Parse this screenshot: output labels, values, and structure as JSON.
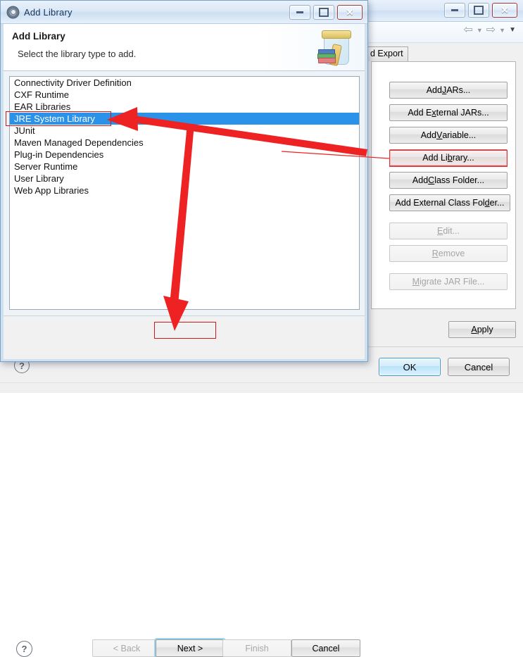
{
  "background_window": {
    "window_controls": [
      {
        "name": "minimize",
        "glyph": "minimize-icon"
      },
      {
        "name": "maximize",
        "glyph": "maximize-icon"
      },
      {
        "name": "close",
        "glyph": "close-icon",
        "label": "✕"
      }
    ],
    "toolbar": {
      "back_arrow": "⇦",
      "back_caret": "▼",
      "forward_arrow": "⇨",
      "forward_caret": "▼",
      "menu_caret": "▼"
    },
    "tab_label": "d Export",
    "buttons": [
      {
        "label_pre": "Add ",
        "mnemonic": "J",
        "label_post": "ARs...",
        "enabled": true,
        "highlighted": false
      },
      {
        "label_pre": "Add E",
        "mnemonic": "x",
        "label_post": "ternal JARs...",
        "enabled": true,
        "highlighted": false
      },
      {
        "label_pre": "Add ",
        "mnemonic": "V",
        "label_post": "ariable...",
        "enabled": true,
        "highlighted": false
      },
      {
        "label_pre": "Add Li",
        "mnemonic": "b",
        "label_post": "rary...",
        "enabled": true,
        "highlighted": true
      },
      {
        "label_pre": "Add ",
        "mnemonic": "C",
        "label_post": "lass Folder...",
        "enabled": true,
        "highlighted": false
      },
      {
        "label_pre": "Add External Class Fol",
        "mnemonic": "d",
        "label_post": "er...",
        "enabled": true,
        "highlighted": false
      },
      {
        "label_pre": "",
        "mnemonic": "E",
        "label_post": "dit...",
        "enabled": false,
        "highlighted": false
      },
      {
        "label_pre": "",
        "mnemonic": "R",
        "label_post": "emove",
        "enabled": false,
        "highlighted": false
      },
      {
        "label_pre": "",
        "mnemonic": "M",
        "label_post": "igrate JAR File...",
        "enabled": false,
        "highlighted": false
      }
    ],
    "apply": {
      "label_pre": "",
      "mnemonic": "A",
      "label_post": "pply"
    },
    "help_icon": "?",
    "ok_label": "OK",
    "cancel_label": "Cancel"
  },
  "dialog": {
    "title": "Add Library",
    "icon": "gear-icon",
    "window_controls": [
      {
        "name": "minimize",
        "glyph": "minimize-icon"
      },
      {
        "name": "restore",
        "glyph": "restore-icon"
      },
      {
        "name": "close",
        "glyph": "close-icon",
        "label": "✕"
      }
    ],
    "header": {
      "title": "Add Library",
      "subtitle": "Select the library type to add.",
      "icon": "library-jar-icon"
    },
    "list": {
      "items": [
        {
          "label": "Connectivity Driver Definition",
          "selected": false
        },
        {
          "label": "CXF Runtime",
          "selected": false
        },
        {
          "label": "EAR Libraries",
          "selected": false
        },
        {
          "label": "JRE System Library",
          "selected": true
        },
        {
          "label": "JUnit",
          "selected": false
        },
        {
          "label": "Maven Managed Dependencies",
          "selected": false
        },
        {
          "label": "Plug-in Dependencies",
          "selected": false
        },
        {
          "label": "Server Runtime",
          "selected": false
        },
        {
          "label": "User Library",
          "selected": false
        },
        {
          "label": "Web App Libraries",
          "selected": false
        }
      ],
      "selection_color": "#2a92e8"
    },
    "footer": {
      "help_icon": "?",
      "back_label": "< Back",
      "back_enabled": false,
      "next_label": "Next >",
      "next_enabled": true,
      "finish_label": "Finish",
      "finish_enabled": false,
      "cancel_label": "Cancel",
      "cancel_enabled": true
    }
  },
  "annotations": {
    "color": "#ee2222",
    "highlight_boxes": [
      "jre-system-library-row",
      "add-library-button",
      "next-button"
    ],
    "arrows": [
      {
        "from": "add-library-button",
        "to": "jre-system-library-row"
      },
      {
        "from": "jre-system-library-row",
        "to": "next-button"
      }
    ]
  }
}
